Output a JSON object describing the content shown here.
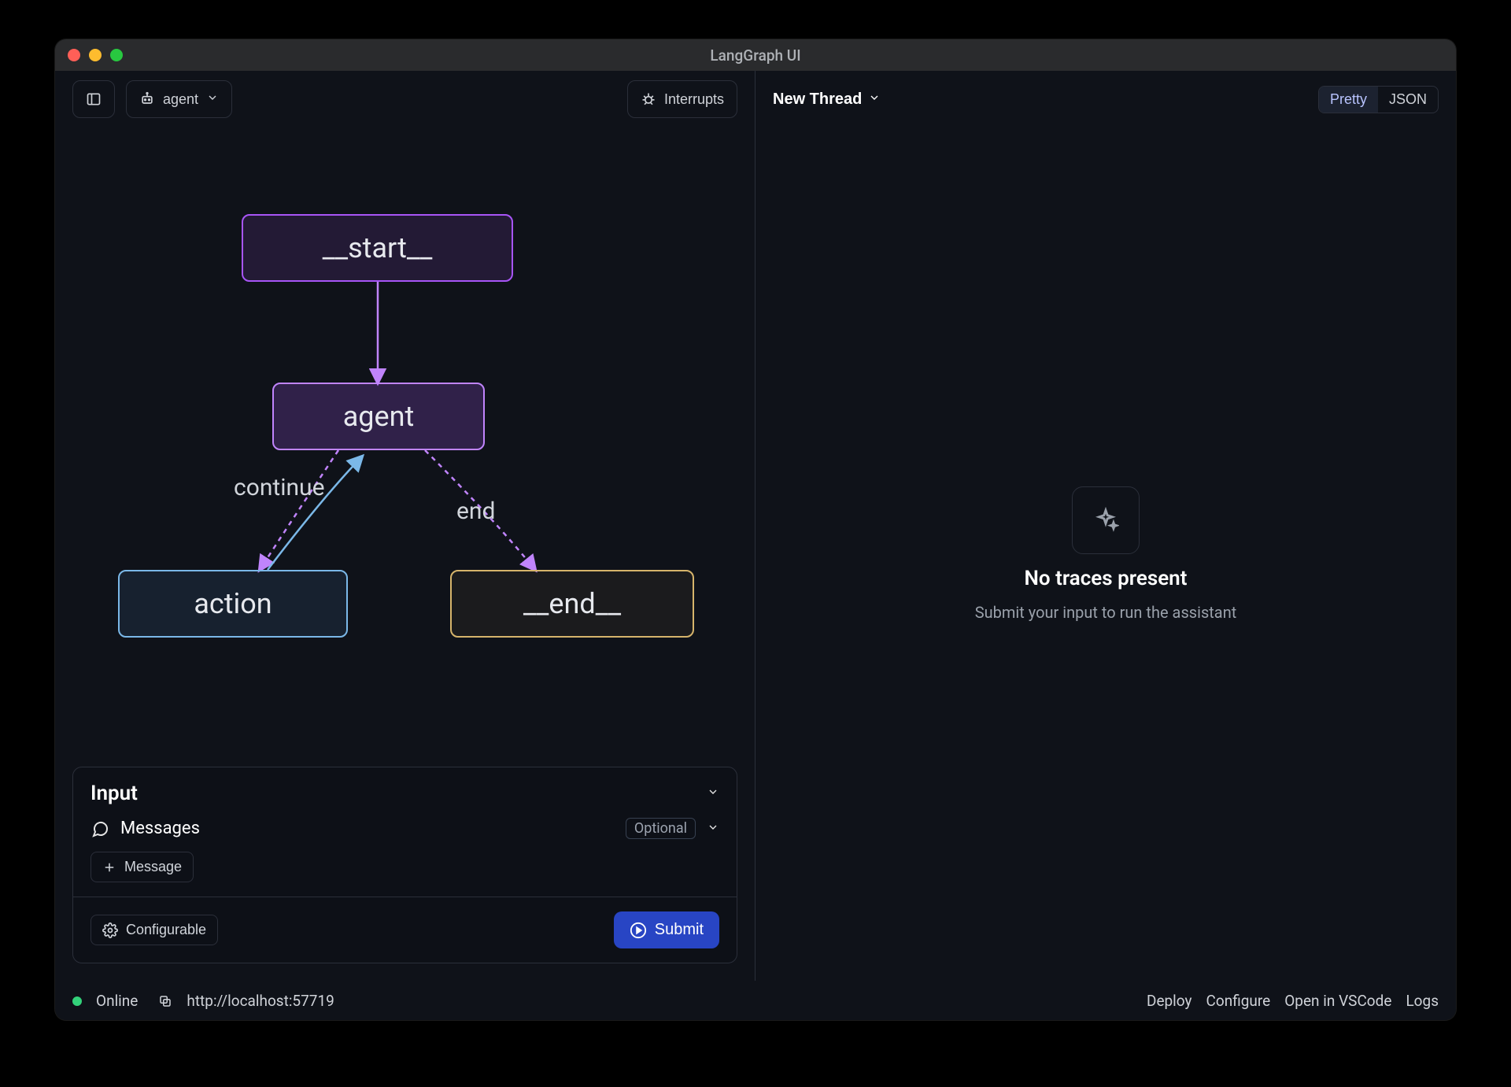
{
  "window": {
    "title": "LangGraph UI"
  },
  "toolbar": {
    "agent_label": "agent",
    "interrupts_label": "Interrupts"
  },
  "graph": {
    "nodes": {
      "start": "__start__",
      "agent": "agent",
      "action": "action",
      "end": "__end__"
    },
    "edge_labels": {
      "continue": "continue",
      "end": "end"
    }
  },
  "input_panel": {
    "title": "Input",
    "messages_label": "Messages",
    "optional_badge": "Optional",
    "add_message_label": "Message",
    "configurable_label": "Configurable",
    "submit_label": "Submit"
  },
  "right": {
    "thread_label": "New Thread",
    "view_tabs": {
      "pretty": "Pretty",
      "json": "JSON"
    },
    "empty_title": "No traces present",
    "empty_sub": "Submit your input to run the assistant"
  },
  "statusbar": {
    "online_label": "Online",
    "url": "http://localhost:57719",
    "links": {
      "deploy": "Deploy",
      "configure": "Configure",
      "open_vscode": "Open in VSCode",
      "logs": "Logs"
    }
  }
}
